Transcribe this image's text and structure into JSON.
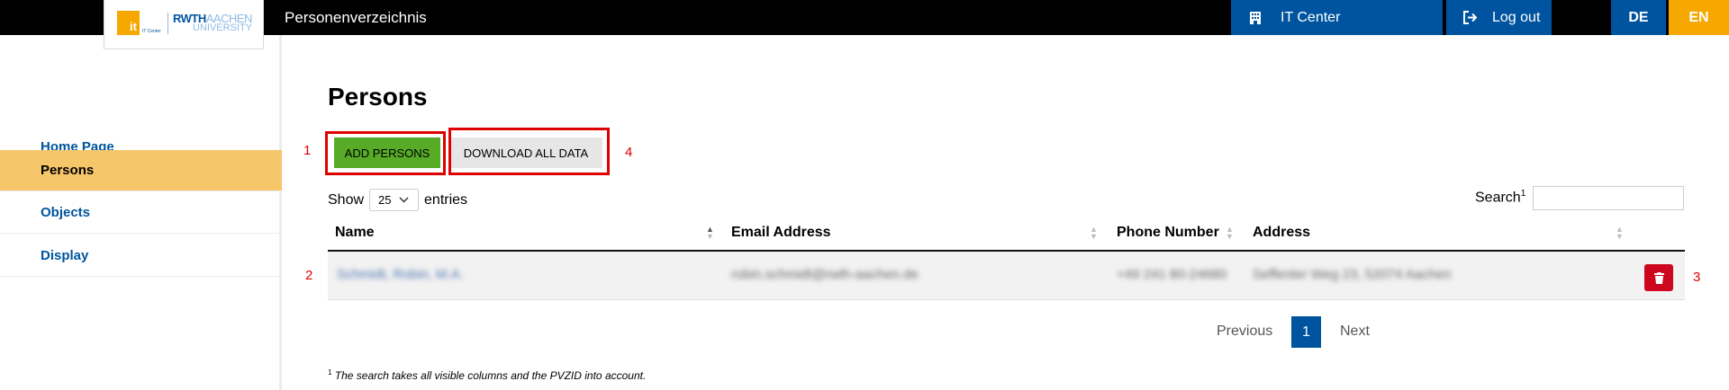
{
  "header": {
    "app_title": "Personenverzeichnis",
    "it_center_label": "IT Center",
    "logout_label": "Log out",
    "lang_de": "DE",
    "lang_en": "EN",
    "logo": {
      "it": "it",
      "it_center": "IT Center",
      "rwth": "RWTH",
      "aachen": "AACHEN",
      "university": "UNIVERSITY"
    }
  },
  "sidebar": {
    "items": [
      {
        "label": "Home Page",
        "active": false
      },
      {
        "label": "Persons",
        "active": true
      },
      {
        "label": "Objects",
        "active": false
      },
      {
        "label": "Display",
        "active": false
      }
    ]
  },
  "main": {
    "title": "Persons",
    "add_button": "ADD PERSONS",
    "download_button": "DOWNLOAD ALL DATA",
    "show_label": "Show",
    "page_length": "25",
    "entries_label": "entries",
    "search_label": "Search",
    "search_footnote_mark": "1",
    "search_value": "",
    "columns": [
      "Name",
      "Email Address",
      "Phone Number",
      "Address"
    ],
    "rows": [
      {
        "name": "Schmidt, Robin, M.A.",
        "email": "robin.schmidt@rwth-aachen.de",
        "phone": "+49 241 80-24680",
        "address": "Seffenter Weg 23, 52074 Aachen"
      }
    ],
    "pagination": {
      "previous": "Previous",
      "current": "1",
      "next": "Next"
    },
    "footnote_mark": "1",
    "footnote": "The search takes all visible columns and the PVZID into account."
  },
  "annotations": {
    "m1": "1",
    "m2": "2",
    "m3": "3",
    "m4": "4",
    "color": "#e00000"
  },
  "colors": {
    "brand_blue": "#00549f",
    "orange": "#f6a800",
    "green": "#57ab27",
    "active_nav": "#f5c66a",
    "delete_red": "#cc071e"
  }
}
